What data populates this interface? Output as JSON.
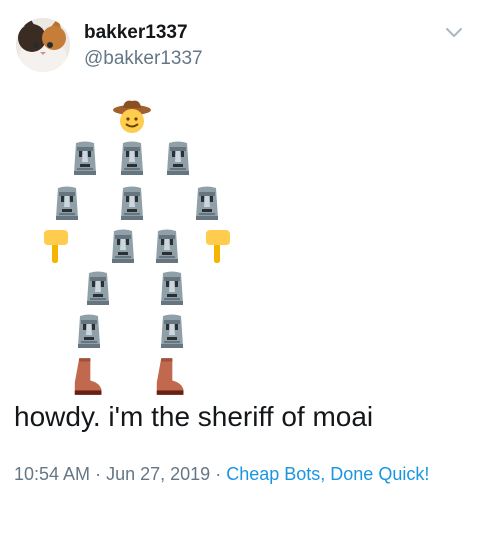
{
  "user": {
    "display_name": "bakker1337",
    "handle": "@bakker1337"
  },
  "tweet": {
    "text": "howdy. i'm the sheriff of moai",
    "time": "10:54 AM",
    "sep1": "·",
    "date": "Jun 27, 2019",
    "sep2": "·",
    "source": "Cheap Bots, Done Quick!"
  },
  "emoji_art": [
    "cowboy-hat-face",
    "moai",
    "backhand-index-pointing-down",
    "womans-boot"
  ],
  "colors": {
    "link": "#1b95e0",
    "muted": "#657786",
    "text": "#14171a"
  }
}
